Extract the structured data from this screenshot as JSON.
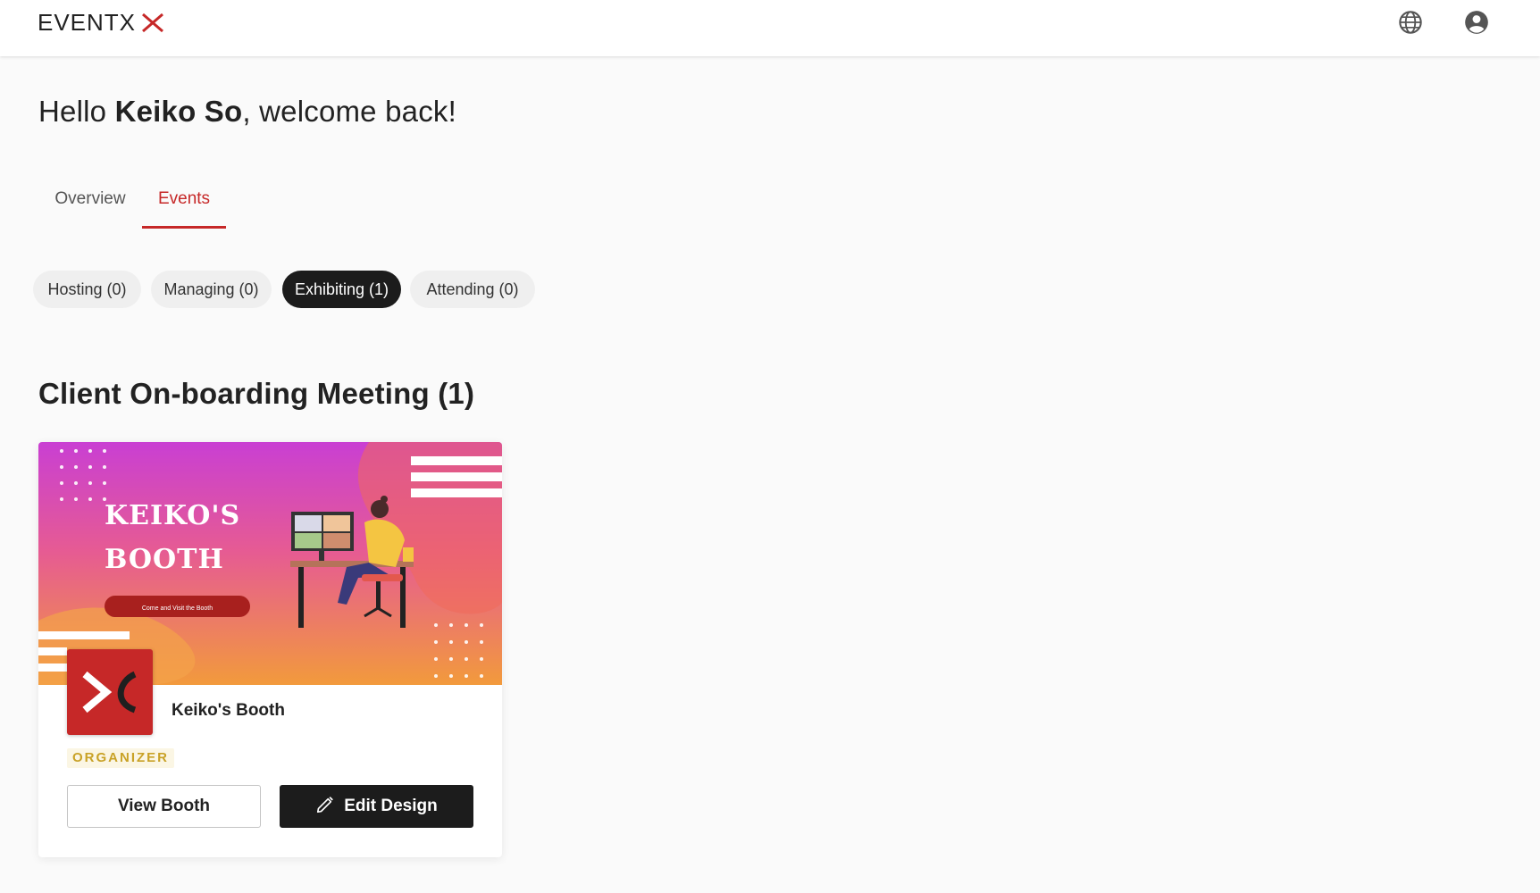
{
  "header": {
    "logo_text": "EVENTX",
    "language_icon": "globe-icon",
    "account_icon": "account-circle-icon"
  },
  "greeting": {
    "prefix": "Hello ",
    "name": "Keiko So",
    "suffix": ", welcome back!"
  },
  "tabs": [
    {
      "label": "Overview",
      "active": false
    },
    {
      "label": "Events",
      "active": true
    }
  ],
  "filters": [
    {
      "label": "Hosting (0)",
      "active": false
    },
    {
      "label": "Managing (0)",
      "active": false
    },
    {
      "label": "Exhibiting (1)",
      "active": true
    },
    {
      "label": "Attending (0)",
      "active": false
    }
  ],
  "section": {
    "title": "Client On-boarding Meeting (1)"
  },
  "booth_card": {
    "banner": {
      "title_line1": "KEIKO'S",
      "title_line2": "BOOTH",
      "pill_text": "Come and Visit the Booth"
    },
    "name": "Keiko's Booth",
    "role": "ORGANIZER",
    "view_button": "View Booth",
    "edit_button": "Edit Design"
  },
  "colors": {
    "accent_red": "#c62828",
    "dark": "#1c1c1c",
    "badge_gold": "#c9a227",
    "banner_gradient_top": "#c93fd3",
    "banner_gradient_bottom": "#f29a3c"
  }
}
